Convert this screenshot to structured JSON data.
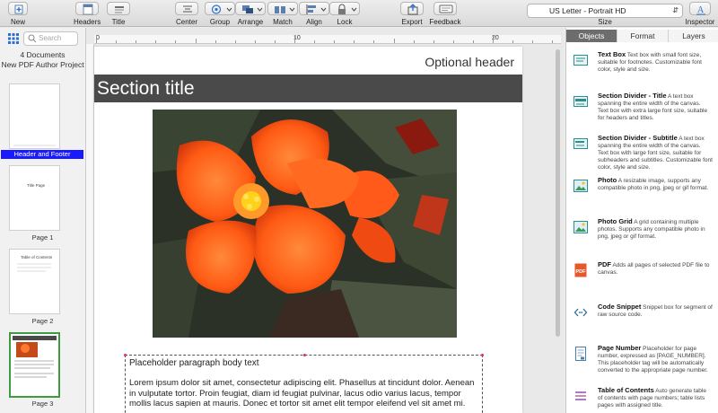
{
  "toolbar": {
    "new_label": "New",
    "headers_label": "Headers",
    "title_label": "Title",
    "center_label": "Center",
    "group_label": "Group",
    "arrange_label": "Arrange",
    "match_label": "Match",
    "align_label": "Align",
    "lock_label": "Lock",
    "export_label": "Export",
    "feedback_label": "Feedback",
    "size_value": "US Letter - Portrait HD",
    "size_label": "Size",
    "inspector_label": "Inspector"
  },
  "sidebar": {
    "search_placeholder": "Search",
    "doc_count": "4 Documents",
    "project_name": "New PDF Author Project",
    "pages": [
      {
        "caption": "Header and Footer",
        "selected": true
      },
      {
        "caption": "Page 1",
        "mini": "Title Page"
      },
      {
        "caption": "Page 2",
        "mini": "Table of Contents"
      },
      {
        "caption": "Page 3"
      }
    ]
  },
  "ruler": {
    "labels": [
      "0",
      "10",
      "20"
    ]
  },
  "page": {
    "optional_header": "Optional header",
    "section_title": "Section title",
    "body_title": "Placeholder paragraph body text",
    "body_text": "Lorem ipsum dolor sit amet, consectetur adipiscing elit. Phasellus at tincidunt dolor. Aenean in vulputate tortor. Proin feugiat, diam id feugiat pulvinar, lacus odio varius lacus, tempor mollis lacus sapien at mauris. Donec et tortor sit amet elit tempor eleifend vel sit amet mi."
  },
  "inspector": {
    "tabs": [
      "Objects",
      "Format",
      "Layers"
    ],
    "active_tab": "Objects",
    "objects": [
      {
        "icon": "text-box-icon",
        "name": "Text Box",
        "desc": "Text box with small font size, suitable for footnotes. Customizable font color, style and size."
      },
      {
        "icon": "section-divider-icon",
        "name": "Section Divider - Title",
        "desc": "A text box spanning the entire width of the canvas. Text box with extra large font size, suitable for headers and titles."
      },
      {
        "icon": "section-divider-subtitle-icon",
        "name": "Section Divider - Subtitle",
        "desc": "A text box spanning the entire width of the canvas. Text box with large font size, suitable for subheaders and subtitles. Customizable font color, style and size."
      },
      {
        "icon": "photo-icon",
        "name": "Photo",
        "desc": "A resizable image, supports any compatible photo in png, jpeg or gif format."
      },
      {
        "icon": "photo-grid-icon",
        "name": "Photo Grid",
        "desc": "A grid containing multiple photos.  Supports any compatible photo in png, jpeg or gif format."
      },
      {
        "icon": "pdf-icon",
        "name": "PDF",
        "desc": "Adds all pages of selected PDF file to canvas."
      },
      {
        "icon": "code-snippet-icon",
        "name": "Code Snippet",
        "desc": "Snippet box for segment of raw source code."
      },
      {
        "icon": "page-number-icon",
        "name": "Page Number",
        "desc": "Placeholder for page number, expressed as [PAGE_NUMBER]. This placeholder tag will be automatically converted to the appropriate page number."
      },
      {
        "icon": "table-of-contents-icon",
        "name": "Table of Contents",
        "desc": "Auto generate table of contents with page numbers; table lists pages with assigned title."
      }
    ]
  },
  "colors": {
    "selection_blue": "#1a1aff",
    "section_bar": "#4a4a4a",
    "active_thumb": "#3f9b3f",
    "icon_teal": "#2a8f8f"
  }
}
